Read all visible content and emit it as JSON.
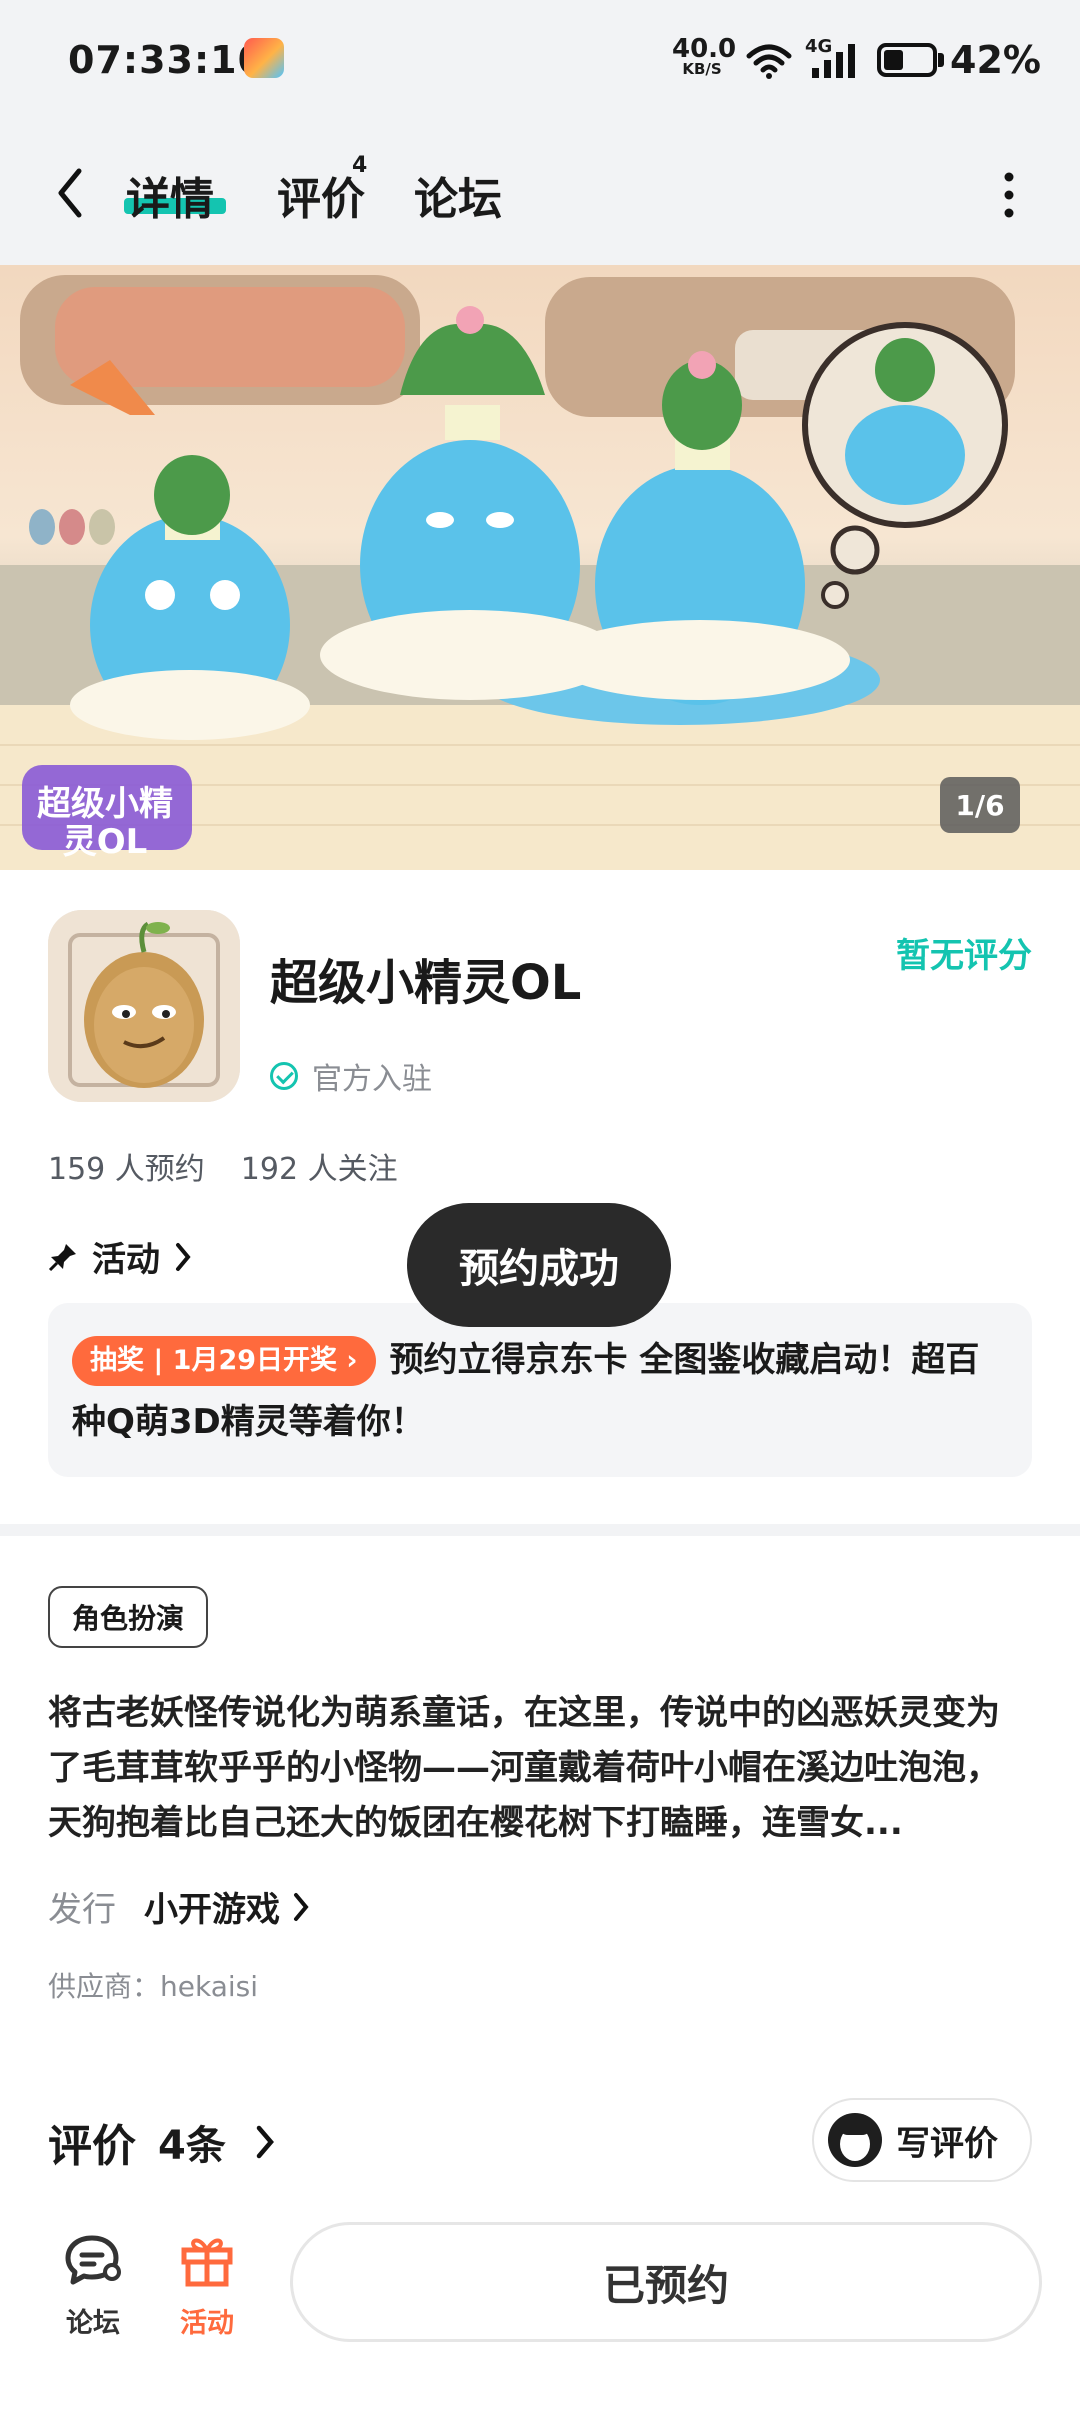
{
  "status_bar": {
    "time": "07:33:10",
    "net_speed_value": "40.0",
    "net_speed_unit": "KB/S",
    "network": "4G",
    "battery_percent": "42%",
    "battery_level": 0.42
  },
  "nav": {
    "tabs": [
      {
        "label": "详情",
        "active": true
      },
      {
        "label": "评价",
        "badge": "4"
      },
      {
        "label": "论坛"
      }
    ]
  },
  "banner": {
    "page_indicator": "1/6",
    "logo_text": "超级小精灵OL"
  },
  "app": {
    "name": "超级小精灵OL",
    "official_label": "官方入驻",
    "rating_text": "暂无评分",
    "stats": [
      "159 人预约",
      "192 人关注"
    ]
  },
  "activity": {
    "title": "活动",
    "tag": "抽奖 | 1月29日开奖",
    "text": "预约立得京东卡 全图鉴收藏启动！超百种Q萌3D精灵等着你！"
  },
  "toast": "预约成功",
  "details": {
    "genre": "角色扮演",
    "description": "将古老妖怪传说化为萌系童话，在这里，传说中的凶恶妖灵变为了毛茸茸软乎乎的小怪物——河童戴着荷叶小帽在溪边吐泡泡，天狗抱着比自己还大的饭团在樱花树下打瞌睡，连雪女...",
    "publisher_label": "发行",
    "publisher": "小开游戏",
    "supplier": "供应商：hekaisi"
  },
  "reviews": {
    "title": "评价",
    "count": "4条",
    "write_button": "写评价"
  },
  "bottom_bar": {
    "forum_label": "论坛",
    "activity_label": "活动",
    "reserved_button": "已预约"
  },
  "colors": {
    "accent": "#14c4b0",
    "orange": "#ff6a3d",
    "toast_bg": "#2a2a2a"
  }
}
